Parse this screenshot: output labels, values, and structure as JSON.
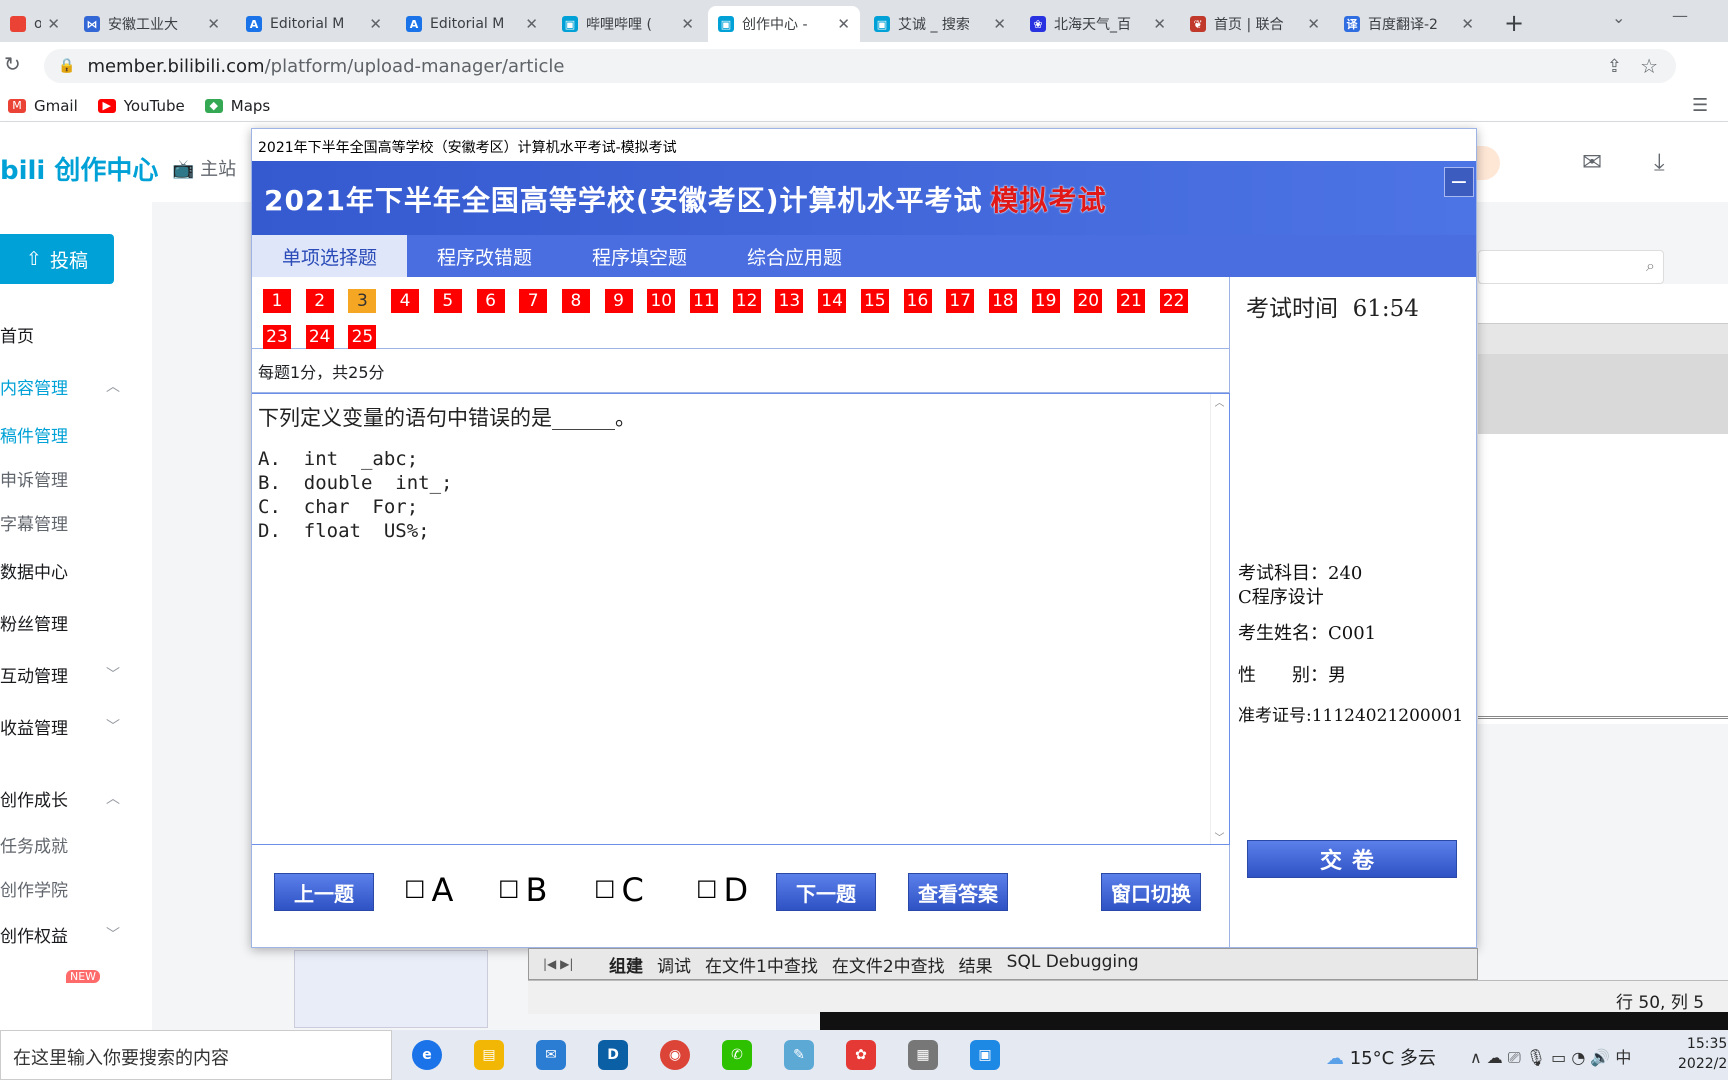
{
  "browser": {
    "tabs": [
      {
        "label": "o Mai",
        "color": "#ea4335",
        "glyph": "",
        "active": false
      },
      {
        "label": "安徽工业大",
        "color": "#3367d6",
        "glyph": "⋈",
        "active": false
      },
      {
        "label": "Editorial M",
        "color": "#1a73e8",
        "glyph": "A",
        "active": false
      },
      {
        "label": "Editorial M",
        "color": "#1a73e8",
        "glyph": "A",
        "active": false
      },
      {
        "label": "哔哩哔哩 (",
        "color": "#00a1d6",
        "glyph": "▣",
        "active": false
      },
      {
        "label": "创作中心 - ",
        "color": "#00a1d6",
        "glyph": "▣",
        "active": true
      },
      {
        "label": "艾诚 _ 搜索",
        "color": "#00a1d6",
        "glyph": "▣",
        "active": false
      },
      {
        "label": "北海天气_百",
        "color": "#2932e1",
        "glyph": "❀",
        "active": false
      },
      {
        "label": "首页 | 联合",
        "color": "#c0392b",
        "glyph": "❦",
        "active": false
      },
      {
        "label": "百度翻译-2",
        "color": "#2f6de1",
        "glyph": "译",
        "active": false
      }
    ],
    "new_tab": "+",
    "url_domain": "member.bilibili.com",
    "url_path": "/platform/upload-manager/article",
    "bookmarks": [
      {
        "label": "Gmail",
        "color": "#ea4335",
        "glyph": "M"
      },
      {
        "label": "YouTube",
        "color": "#ff0000",
        "glyph": "▶"
      },
      {
        "label": "Maps",
        "color": "#34a853",
        "glyph": "◆"
      }
    ]
  },
  "bili": {
    "logo": "bili 创作中心",
    "home": "主站",
    "upload_label": "投稿",
    "sidebar": [
      {
        "label": "首页",
        "top": 0,
        "kind": "main"
      },
      {
        "label": "内容管理",
        "kind": "main-sel",
        "chev": "︿"
      },
      {
        "label": "稿件管理",
        "kind": "sub-sel"
      },
      {
        "label": "申诉管理",
        "kind": "sub"
      },
      {
        "label": "字幕管理",
        "kind": "sub"
      },
      {
        "label": "数据中心",
        "kind": "main"
      },
      {
        "label": "粉丝管理",
        "kind": "main"
      },
      {
        "label": "互动管理",
        "kind": "main",
        "chev": "﹀"
      },
      {
        "label": "收益管理",
        "kind": "main",
        "chev": "﹀"
      },
      {
        "label": "创作成长",
        "kind": "main",
        "chev": "︿"
      },
      {
        "label": "任务成就",
        "kind": "sub"
      },
      {
        "label": "创作学院",
        "kind": "sub"
      },
      {
        "label": "创作权益",
        "kind": "main",
        "chev": "﹀"
      }
    ],
    "new_badge": "NEW"
  },
  "exam": {
    "window_title": "2021年下半年全国高等学校（安徽考区）计算机水平考试-模拟考试",
    "banner_title": "2021年下半年全国高等学校(安徽考区)计算机水平考试",
    "banner_tag": "模拟考试",
    "minimize": "−",
    "tabs": [
      "单项选择题",
      "程序改错题",
      "程序填空题",
      "综合应用题"
    ],
    "question_numbers": [
      "1",
      "2",
      "3",
      "4",
      "5",
      "6",
      "7",
      "8",
      "9",
      "10",
      "11",
      "12",
      "13",
      "14",
      "15",
      "16",
      "17",
      "18",
      "19",
      "20",
      "21",
      "22",
      "23",
      "24",
      "25"
    ],
    "current_question": "3",
    "score_line": "每题1分，共25分",
    "question": "下列定义变量的语句中错误的是______。",
    "options": [
      "A.  int  _abc;",
      "B.  double  int_;",
      "C.  char  For;",
      "D.  float  US%;"
    ],
    "prev_button": "上一题",
    "next_button": "下一题",
    "answer_button": "查看答案",
    "switch_button": "窗口切换",
    "choices": [
      "A",
      "B",
      "C",
      "D"
    ],
    "check_glyph": "☐",
    "timer_label": "考试时间",
    "timer_value": "61:54",
    "subject_label": "考试科目：240",
    "subject_name": "C程序设计",
    "name_label": "考生姓名：C001",
    "gender_label": "性　　别：男",
    "ticket_label": "准考证号:11124021200001",
    "submit_button": "交卷"
  },
  "ide": {
    "tabs": [
      "组建",
      "调试",
      "在文件1中查找",
      "在文件2中查找",
      "结果",
      "SQL Debugging"
    ],
    "rowcol": "行 50, 列 5"
  },
  "taskbar": {
    "search_placeholder": "在这里输入你要搜索的内容",
    "weather": "15°C 多云",
    "tray": "∧ ☁ ⎚ 🎙 ▭ ◔ 🔊 中",
    "time": "15:35",
    "date": "2022/2"
  }
}
